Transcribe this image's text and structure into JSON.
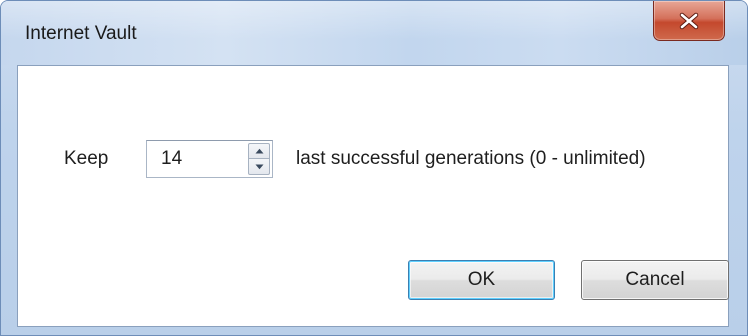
{
  "window": {
    "title": "Internet Vault",
    "close_icon": "close-x-icon"
  },
  "form": {
    "keep_label": "Keep",
    "generations_value": "14",
    "description": "last successful generations (0 - unlimited)",
    "spin_up_icon": "arrow-up-icon",
    "spin_down_icon": "arrow-down-icon"
  },
  "buttons": {
    "ok_label": "OK",
    "cancel_label": "Cancel"
  },
  "colors": {
    "close_button": "#c4482d",
    "ok_focus_border": "#3c7fb1",
    "title_bar": "#c5d7ee"
  }
}
